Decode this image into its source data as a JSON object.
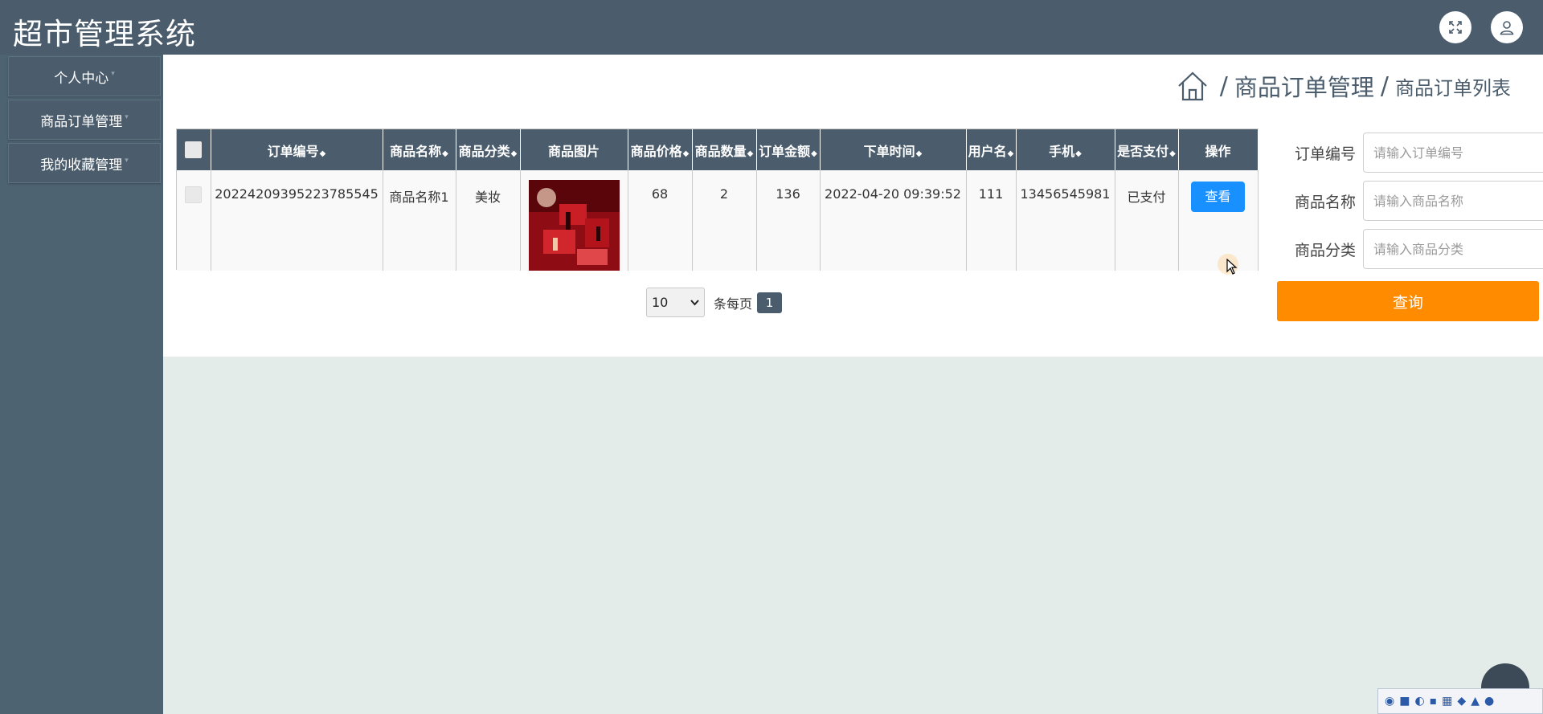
{
  "app": {
    "title": "超市管理系统"
  },
  "header": {
    "fullscreen_icon": "expand-icon",
    "user_icon": "user-icon"
  },
  "sidebar": {
    "items": [
      {
        "label": "个人中心"
      },
      {
        "label": "商品订单管理"
      },
      {
        "label": "我的收藏管理"
      }
    ]
  },
  "breadcrumb": {
    "home_icon": "home-icon",
    "separator": "/",
    "section": "商品订单管理",
    "page": "商品订单列表"
  },
  "table": {
    "columns": [
      "订单编号",
      "商品名称",
      "商品分类",
      "商品图片",
      "商品价格",
      "商品数量",
      "订单金额",
      "下单时间",
      "用户名",
      "手机",
      "是否支付",
      "操作"
    ],
    "sortable_marker": "◆",
    "rows": [
      {
        "order_no": "20224209395223785545",
        "product_name": "商品名称1",
        "category": "美妆",
        "price": "68",
        "quantity": "2",
        "amount": "136",
        "order_time": "2022-04-20 09:39:52",
        "username": "111",
        "phone": "13456545981",
        "paid": "已支付",
        "action_label": "查看"
      }
    ]
  },
  "pagination": {
    "page_size": "10",
    "per_page_label": "条每页",
    "current_page": "1"
  },
  "search": {
    "order_no_label": "订单编号",
    "order_no_placeholder": "请输入订单编号",
    "product_name_label": "商品名称",
    "product_name_placeholder": "请输入商品名称",
    "category_label": "商品分类",
    "category_placeholder": "请输入商品分类",
    "submit_label": "查询"
  },
  "colors": {
    "header_bg": "#4b5d6c",
    "sidebar_bg": "#4d6371",
    "primary_button": "#1890ff",
    "search_button": "#ff8c00",
    "page_bg": "#e4ecea"
  }
}
